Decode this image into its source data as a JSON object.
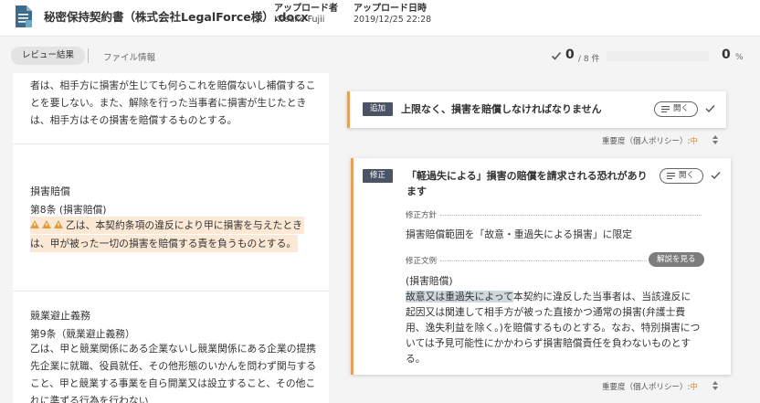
{
  "header": {
    "doc_title": "秘密保持契約書（株式会社LegalForce様）.docx",
    "uploader_label": "アップロード者",
    "uploader_value": "Kosuke Fujii",
    "date_label": "アップロード日時",
    "date_value": "2019/12/25 22:28"
  },
  "toolbar": {
    "tab_review": "レビュー結果",
    "tab_file": "ファイル情報",
    "count": "0",
    "count_total": "/ 8 件",
    "progress_value": 0,
    "percent": "0",
    "percent_sign": "%"
  },
  "document": {
    "para1": "者は、相手方に損害が生じても何らこれを賠償ないし補償することを要しない。また、解除を行った当事者に損害が生じたときは、相手方はその損害を賠償するものとする。",
    "sec2_title": "損害賠償",
    "sec2_article": "第8条 (損害賠償)",
    "sec2_line1": "乙は、本契約条項の違反により甲に損害を与えたとき",
    "sec2_line2": "は、甲が被った一切の損害を賠償する責を負うものとする。",
    "sec3_title": "競業避止義務",
    "sec3_article": "第9条（競業避止義務）",
    "sec3_body": "乙は、甲と競業関係にある企業ないし競業関係にある企業の提携先企業に就職、役員就任、その他形態のいかんを問わず関与すること、甲と競業する事業を自ら開業又は設立すること、その他これに準ずる行為を行わない"
  },
  "card1": {
    "tag": "追加",
    "title": "上限なく、損害を賠償しなければなりません",
    "open_label": "開く",
    "severity_label": "重要度（個人ポリシー）:",
    "severity_value": "中"
  },
  "card2": {
    "tag": "修正",
    "title": "「軽過失による」損害の賠償を請求される恐れがあります",
    "open_label": "開く",
    "policy_label": "修正方針",
    "policy_text": "損害賠償範囲を「故意・重過失による損害」に限定",
    "example_label": "修正文例",
    "explain_label": "解説を見る",
    "example_heading": "(損害賠償)",
    "example_highlight": "故意又は重過失によって",
    "example_body": "本契約に違反した当事者は、当該違反に起因又は関連して相手方が被った直接かつ通常の損害(弁護士費用、逸失利益を除く。)を賠償するものとする。なお、特別損害については予見可能性にかかわらず損害賠償責任を負わないものとする。",
    "severity_label": "重要度（個人ポリシー）:",
    "severity_value": "中"
  },
  "colors": {
    "accent": "#e8a15a",
    "tag_bg": "#4a5465",
    "highlight": "#fbe9d6",
    "severity_mid": "#e58a2a"
  }
}
